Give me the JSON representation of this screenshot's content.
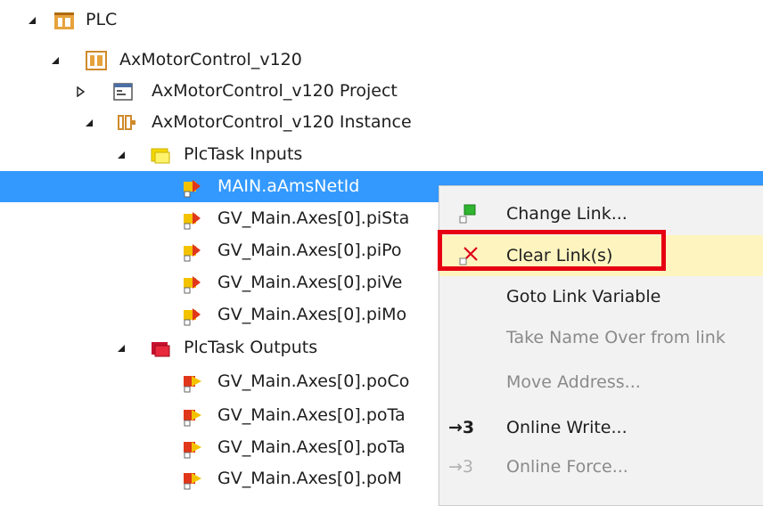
{
  "tree": {
    "rows": [
      {
        "label": "PLC",
        "expander": "expanded",
        "icon": "plc-folder-icon"
      },
      {
        "label": "AxMotorControl_v120",
        "expander": "expanded",
        "icon": "plc-project-icon"
      },
      {
        "label": "AxMotorControl_v120 Project",
        "expander": "collapsed",
        "icon": "project-file-icon"
      },
      {
        "label": "AxMotorControl_v120 Instance",
        "expander": "expanded",
        "icon": "instance-icon"
      },
      {
        "label": "PlcTask Inputs",
        "expander": "expanded",
        "icon": "input-folder-icon"
      },
      {
        "label": "MAIN.aAmsNetId",
        "selected": true,
        "icon": "input-variable-icon"
      },
      {
        "label": "GV_Main.Axes[0].piSta",
        "icon": "input-variable-icon"
      },
      {
        "label": "GV_Main.Axes[0].piPo",
        "icon": "input-variable-icon"
      },
      {
        "label": "GV_Main.Axes[0].piVe",
        "icon": "input-variable-icon"
      },
      {
        "label": "GV_Main.Axes[0].piMo",
        "icon": "input-variable-icon"
      },
      {
        "label": "PlcTask Outputs",
        "expander": "expanded",
        "icon": "output-folder-icon"
      },
      {
        "label": "GV_Main.Axes[0].poCo",
        "icon": "output-variable-icon"
      },
      {
        "label": "GV_Main.Axes[0].poTa",
        "icon": "output-variable-icon"
      },
      {
        "label": "GV_Main.Axes[0].poTa",
        "icon": "output-variable-icon"
      },
      {
        "label": "GV_Main.Axes[0].poM",
        "icon": "output-variable-icon"
      }
    ]
  },
  "context_menu": {
    "items": [
      {
        "label": "Change Link...",
        "icon": "change-link-icon",
        "enabled": true
      },
      {
        "label": "Clear Link(s)",
        "icon": "clear-link-icon",
        "enabled": true,
        "highlighted": true
      },
      {
        "label": "Goto Link Variable",
        "enabled": true
      },
      {
        "label": "Take Name Over from link",
        "enabled": false
      },
      {
        "label": "Move Address...",
        "enabled": false
      },
      {
        "label": "Online Write...",
        "glyph": "→3",
        "enabled": true
      },
      {
        "label": "Online Force...",
        "glyph": "→3",
        "enabled": false
      }
    ]
  },
  "colors": {
    "selection": "#3399ff",
    "menu_highlight": "#fdf4bf",
    "callout_border": "#e60012"
  }
}
